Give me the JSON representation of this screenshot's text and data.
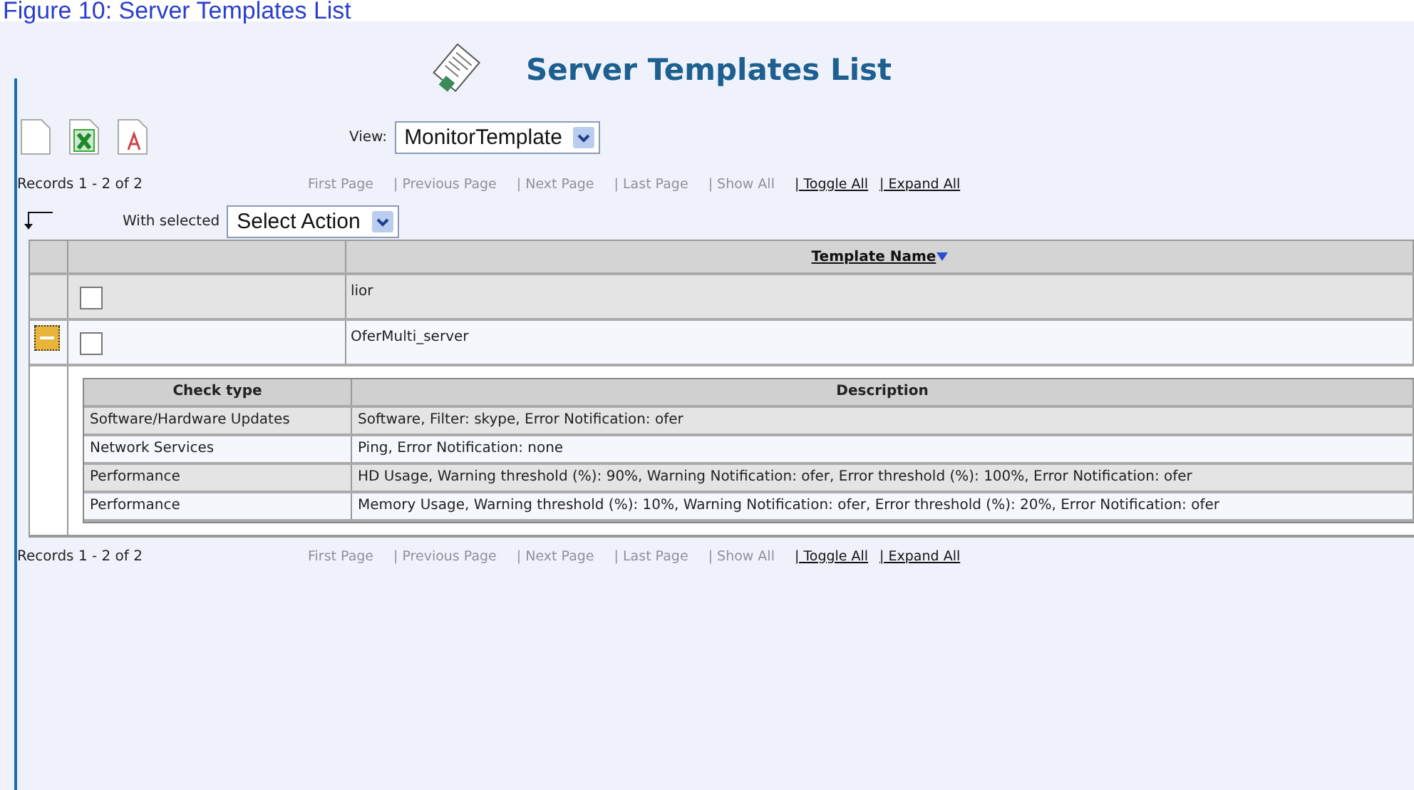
{
  "caption": "Figure 10: Server Templates List",
  "title": "Server Templates List",
  "view": {
    "label": "View:",
    "value": "MonitorTemplate"
  },
  "pager_top": {
    "records": "Records 1 - 2 of 2",
    "links": [
      {
        "label": "First Page",
        "disabled": true
      },
      {
        "label": "| Previous Page",
        "disabled": true
      },
      {
        "label": "| Next Page",
        "disabled": true
      },
      {
        "label": "| Last Page",
        "disabled": true
      },
      {
        "label": "| Show All",
        "disabled": true
      },
      {
        "label": "| Toggle All",
        "disabled": false
      },
      {
        "label": "| Expand All",
        "disabled": false
      }
    ]
  },
  "bulk": {
    "label": "With selected",
    "value": "Select Action"
  },
  "table": {
    "columns": [
      "Template Name"
    ],
    "rows": [
      {
        "name": "lior",
        "checked": false,
        "expanded": false
      },
      {
        "name": "OferMulti_server",
        "checked": false,
        "expanded": true,
        "details": {
          "columns": [
            "Check type",
            "Description"
          ],
          "rows": [
            [
              "Software/Hardware Updates",
              "Software, Filter: skype, Error Notification: ofer"
            ],
            [
              "Network Services",
              "Ping, Error Notification: none"
            ],
            [
              "Performance",
              "HD Usage, Warning threshold (%): 90%, Warning Notification: ofer, Error threshold (%): 100%, Error Notification: ofer"
            ],
            [
              "Performance",
              "Memory Usage, Warning threshold (%): 10%, Warning Notification: ofer, Error threshold (%): 20%, Error Notification: ofer"
            ]
          ]
        }
      }
    ]
  },
  "pager_bottom": {
    "records": "Records 1 - 2 of 2",
    "links": [
      {
        "label": "First Page",
        "disabled": true
      },
      {
        "label": "| Previous Page",
        "disabled": true
      },
      {
        "label": "| Next Page",
        "disabled": true
      },
      {
        "label": "| Last Page",
        "disabled": true
      },
      {
        "label": "| Show All",
        "disabled": true
      },
      {
        "label": "| Toggle All",
        "disabled": false
      },
      {
        "label": "| Expand All",
        "disabled": false
      }
    ]
  }
}
